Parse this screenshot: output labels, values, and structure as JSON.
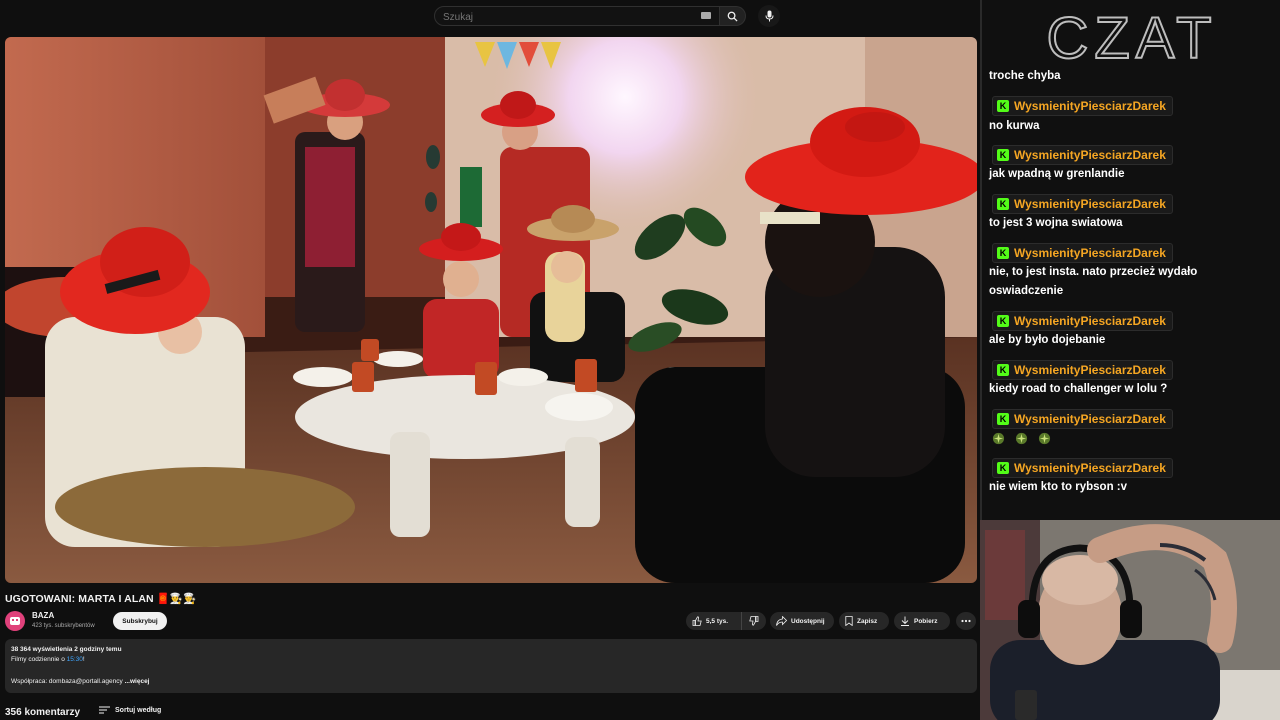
{
  "search": {
    "placeholder": "Szukaj"
  },
  "video": {
    "title": "UGOTOWANI: MARTA I ALAN 🧧👨‍🍳👨‍🍳"
  },
  "channel": {
    "name": "BAZA",
    "subscribers": "423 tys. subskrybentów",
    "subscribe_label": "Subskrybuj"
  },
  "actions": {
    "likes": "5,5 tys.",
    "share": "Udostępnij",
    "save": "Zapisz",
    "download": "Pobierz"
  },
  "description": {
    "stats": "38 364 wyświetlenia  2 godziny temu",
    "line2_prefix": "Filmy codziennie o ",
    "line2_link": "15:30",
    "line2_suffix": "!",
    "line3": "Współpraca: dombaza@portall.agency",
    "more": "...więcej"
  },
  "comments": {
    "count": "356 komentarzy",
    "sort_label": "Sortuj według"
  },
  "chat": {
    "title": "CZAT",
    "badge_letter": "K",
    "first_line": "troche chyba",
    "messages": [
      {
        "user": "WysmienityPiesciarzDarek",
        "text": "no kurwa"
      },
      {
        "user": "WysmienityPiesciarzDarek",
        "text": "jak wpadną w grenlandie"
      },
      {
        "user": "WysmienityPiesciarzDarek",
        "text": "to jest 3 wojna swiatowa"
      },
      {
        "user": "WysmienityPiesciarzDarek",
        "text": "nie, to jest insta. nato przecież wydało",
        "text2": "oswiadczenie"
      },
      {
        "user": "WysmienityPiesciarzDarek",
        "text": "ale by było dojebanie"
      },
      {
        "user": "WysmienityPiesciarzDarek",
        "text": "kiedy road to challenger w lolu ?"
      },
      {
        "user": "WysmienityPiesciarzDarek",
        "emotes": [
          "sparkle-emote",
          "sparkle-emote",
          "sparkle-emote"
        ]
      },
      {
        "user": "WysmienityPiesciarzDarek",
        "text": "nie wiem kto to rybson :v"
      }
    ]
  },
  "colors": {
    "bg": "#0f0f0f",
    "pill": "#272727",
    "username": "#f5a623",
    "badge": "#53fc18",
    "link": "#3ea6ff",
    "hat_red": "#e0201b"
  }
}
